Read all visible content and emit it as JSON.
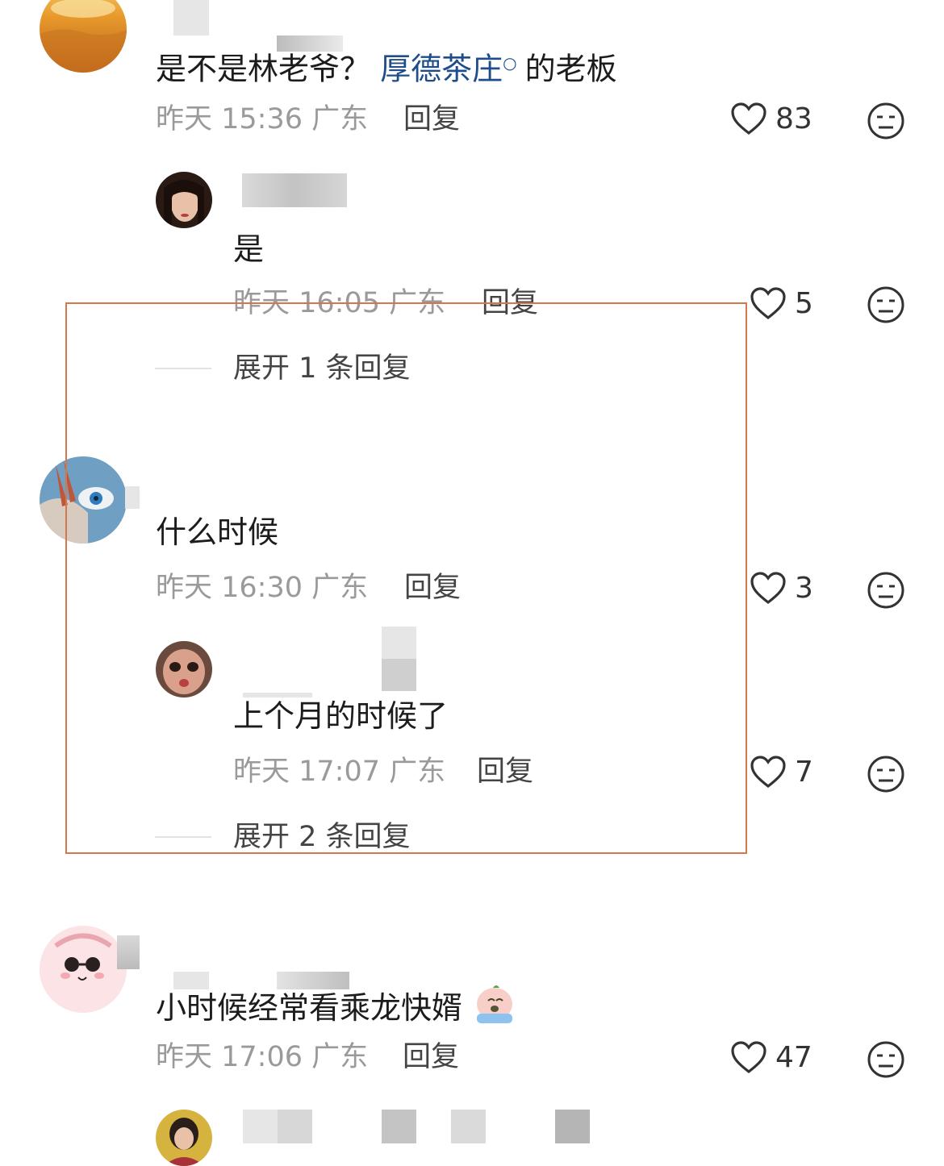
{
  "comments": [
    {
      "text_plain": "是不是林老爷？",
      "text_link": "厚德茶庄",
      "text_after": "的老板",
      "time": "昨天 15:36 广东",
      "reply_label": "回复",
      "likes": "83",
      "replies": [
        {
          "text": "是",
          "time": "昨天 16:05 广东",
          "reply_label": "回复",
          "likes": "5"
        }
      ],
      "expand_label": "展开 1 条回复"
    },
    {
      "text": "什么时候",
      "time": "昨天 16:30 广东",
      "reply_label": "回复",
      "likes": "3",
      "replies": [
        {
          "text": "上个月的时候了",
          "time": "昨天 17:07 广东",
          "reply_label": "回复",
          "likes": "7"
        }
      ],
      "expand_label": "展开 2 条回复"
    },
    {
      "text": "小时候经常看乘龙快婿",
      "emoji": "crying-emoji",
      "time": "昨天 17:06 广东",
      "reply_label": "回复",
      "likes": "47"
    }
  ],
  "colors": {
    "link": "#1f4d8a",
    "meta": "#9a9a9a",
    "highlight": "#d4774a"
  }
}
